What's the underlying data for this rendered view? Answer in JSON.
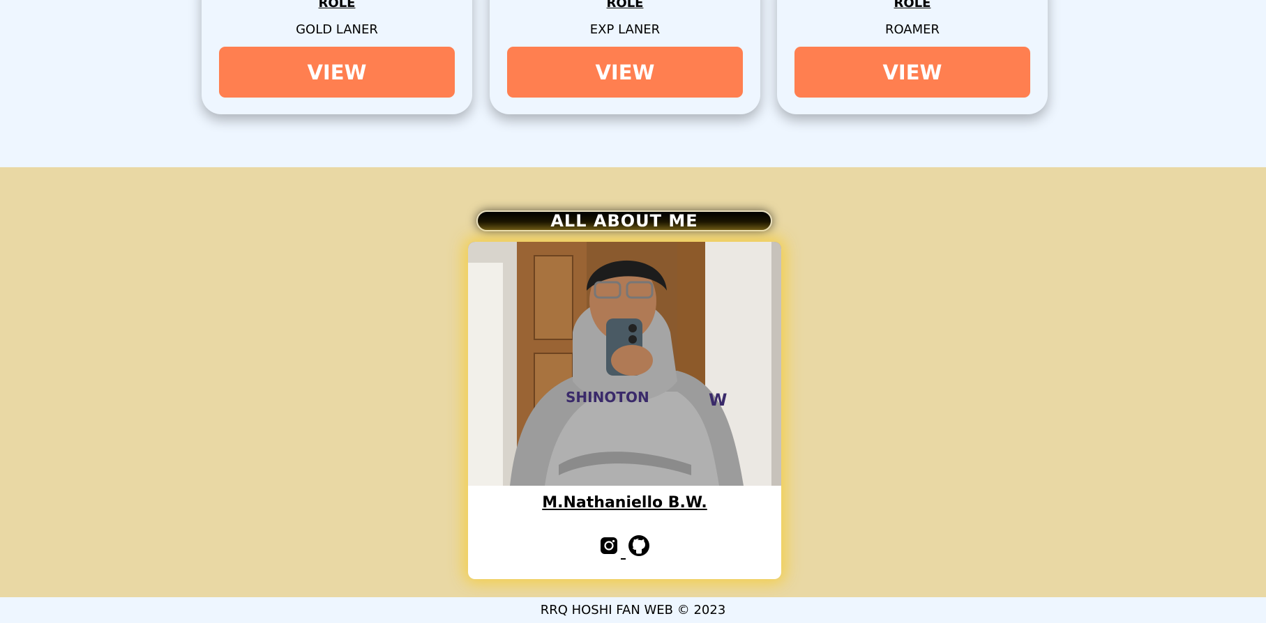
{
  "cards": [
    {
      "role_label": "ROLE",
      "position": "GOLD LANER",
      "button_label": "VIEW"
    },
    {
      "role_label": "ROLE",
      "position": "EXP LANER",
      "button_label": "VIEW"
    },
    {
      "role_label": "ROLE",
      "position": "ROAMER",
      "button_label": "VIEW"
    }
  ],
  "about": {
    "title": "ALL ABOUT ME",
    "name": "M.Nathaniello B.W.",
    "socials": [
      {
        "icon": "instagram-icon"
      },
      {
        "icon": "github-icon"
      }
    ]
  },
  "footer": {
    "text": "RRQ HOSHI FAN WEB © 2023"
  },
  "colors": {
    "page_bg": "#eef6ff",
    "accent_button": "#ff7f50",
    "about_bg": "#e9d8a4",
    "card_glow": "#f5cd3c"
  }
}
